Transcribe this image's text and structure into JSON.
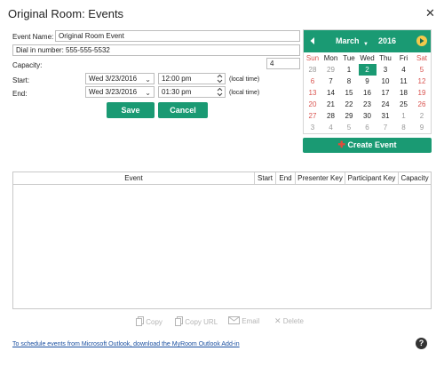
{
  "window": {
    "title": "Original Room: Events",
    "close_glyph": "✕"
  },
  "form": {
    "event_name_label": "Event Name:",
    "event_name_value": "Original Room Event",
    "dial_in": "Dial in number: 555-555-5532",
    "capacity_label": "Capacity:",
    "capacity_value": "4",
    "start_label": "Start:",
    "start_date": "Wed  3/23/2016",
    "start_time": "12:00 pm",
    "end_label": "End:",
    "end_date": "Wed  3/23/2016",
    "end_time": "01:30 pm",
    "local_time": "(local time)",
    "save_label": "Save",
    "cancel_label": "Cancel"
  },
  "calendar": {
    "month": "March",
    "year": "2016",
    "weekdays": [
      "Sun",
      "Mon",
      "Tue",
      "Wed",
      "Thu",
      "Fri",
      "Sat"
    ],
    "weeks": [
      [
        {
          "d": "28",
          "t": "grey"
        },
        {
          "d": "29",
          "t": "grey"
        },
        {
          "d": "1",
          "t": "wk"
        },
        {
          "d": "2",
          "t": "today"
        },
        {
          "d": "3",
          "t": "wk"
        },
        {
          "d": "4",
          "t": "wk"
        },
        {
          "d": "5",
          "t": "red"
        }
      ],
      [
        {
          "d": "6",
          "t": "red"
        },
        {
          "d": "7",
          "t": "wk"
        },
        {
          "d": "8",
          "t": "wk"
        },
        {
          "d": "9",
          "t": "wk"
        },
        {
          "d": "10",
          "t": "wk"
        },
        {
          "d": "11",
          "t": "wk"
        },
        {
          "d": "12",
          "t": "red"
        }
      ],
      [
        {
          "d": "13",
          "t": "red"
        },
        {
          "d": "14",
          "t": "wk"
        },
        {
          "d": "15",
          "t": "wk"
        },
        {
          "d": "16",
          "t": "wk"
        },
        {
          "d": "17",
          "t": "wk"
        },
        {
          "d": "18",
          "t": "wk"
        },
        {
          "d": "19",
          "t": "red"
        }
      ],
      [
        {
          "d": "20",
          "t": "red"
        },
        {
          "d": "21",
          "t": "wk"
        },
        {
          "d": "22",
          "t": "wk"
        },
        {
          "d": "23",
          "t": "wk"
        },
        {
          "d": "24",
          "t": "wk"
        },
        {
          "d": "25",
          "t": "wk"
        },
        {
          "d": "26",
          "t": "red"
        }
      ],
      [
        {
          "d": "27",
          "t": "red"
        },
        {
          "d": "28",
          "t": "wk"
        },
        {
          "d": "29",
          "t": "wk"
        },
        {
          "d": "30",
          "t": "wk"
        },
        {
          "d": "31",
          "t": "wk"
        },
        {
          "d": "1",
          "t": "grey"
        },
        {
          "d": "2",
          "t": "grey"
        }
      ],
      [
        {
          "d": "3",
          "t": "grey"
        },
        {
          "d": "4",
          "t": "grey"
        },
        {
          "d": "5",
          "t": "grey"
        },
        {
          "d": "6",
          "t": "grey"
        },
        {
          "d": "7",
          "t": "grey"
        },
        {
          "d": "8",
          "t": "grey"
        },
        {
          "d": "9",
          "t": "grey"
        }
      ]
    ],
    "create_event_label": "Create Event",
    "prev_icon": "prev-month-icon",
    "next_icon": "next-month-icon"
  },
  "table": {
    "columns": [
      "Event",
      "Start",
      "End",
      "Presenter Key",
      "Participant Key",
      "Capacity"
    ],
    "rows": []
  },
  "toolbar": {
    "copy_label": "Copy",
    "copy_url_label": "Copy URL",
    "email_label": "Email",
    "delete_label": "Delete"
  },
  "footer": {
    "outlook_link": "To schedule events from Microsoft Outlook, download the MyRoom Outlook Add-in",
    "help_glyph": "?"
  },
  "colors": {
    "accent": "#1a9a73",
    "weekend": "#d9534f",
    "link": "#1a4fa0"
  }
}
